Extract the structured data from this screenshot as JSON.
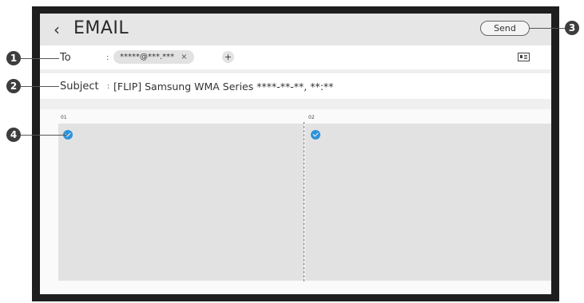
{
  "header": {
    "back_icon": "chevron-left-icon",
    "title": "EMAIL",
    "send_label": "Send"
  },
  "to_row": {
    "label": "To",
    "colon": ":",
    "recipient": "*****@***.***",
    "remove_symbol": "×",
    "add_symbol": "+",
    "contact_icon": "contact-card-icon"
  },
  "subject_row": {
    "label": "Subject",
    "colon": ":",
    "value": "[FLIP] Samsung WMA Series ****-**-**, **:**"
  },
  "pages": [
    {
      "number": "01",
      "selected": true
    },
    {
      "number": "02",
      "selected": true
    }
  ],
  "callouts": [
    "1",
    "2",
    "3",
    "4"
  ],
  "colors": {
    "accent": "#2f93d8",
    "callout": "#3d3d3d"
  }
}
